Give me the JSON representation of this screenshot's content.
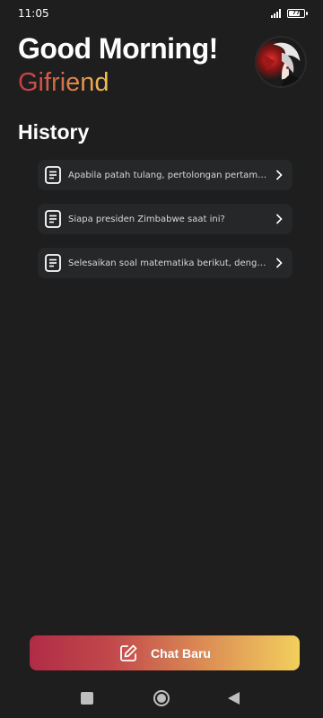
{
  "status_bar": {
    "time": "11:05",
    "network_label": "4G",
    "battery_level": "77"
  },
  "header": {
    "greeting": "Good Morning!",
    "username": "Gifriend",
    "avatar_icon": "anime-avatar"
  },
  "history": {
    "title": "History",
    "items": [
      {
        "label": "Apabila patah tulang, pertolongan pertama apa yang harus dilakukan?"
      },
      {
        "label": "Siapa presiden Zimbabwe saat ini?"
      },
      {
        "label": "Selesaikan soal matematika berikut, dengan langkah-langkah"
      }
    ]
  },
  "new_chat": {
    "label": "Chat Baru",
    "icon": "edit-icon"
  },
  "colors": {
    "background": "#1e1e1e",
    "card": "#252729",
    "gradient_start": "#b02c45",
    "gradient_end": "#f2cf5d"
  }
}
